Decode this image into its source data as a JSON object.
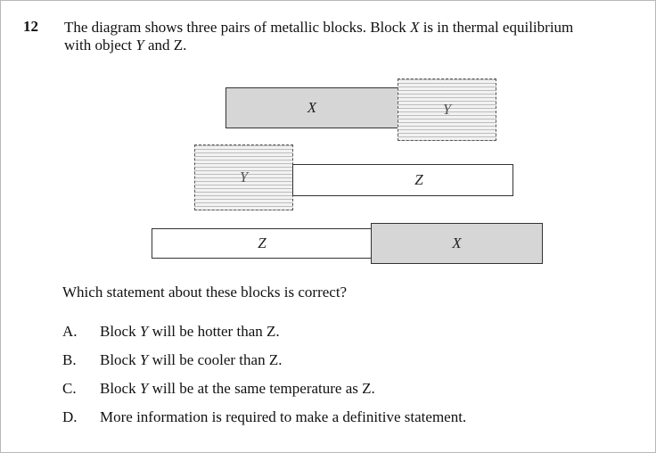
{
  "question": {
    "number": "12",
    "stem_line1_a": "The diagram shows three pairs of metallic blocks. Block ",
    "stem_line1_b": "X",
    "stem_line1_c": " is in thermal equilibrium",
    "stem_line2_a": "with object ",
    "stem_line2_b": "Y",
    "stem_line2_c": " and Z.",
    "prompt": "Which statement about these blocks is correct?"
  },
  "diagram": {
    "pair1": {
      "left": "X",
      "right": "Y"
    },
    "pair2": {
      "left": "Y",
      "right": "Z"
    },
    "pair3": {
      "left": "Z",
      "right": "X"
    }
  },
  "options": [
    {
      "letter": "A.",
      "pre": "Block ",
      "var": "Y",
      "post": " will be hotter than Z."
    },
    {
      "letter": "B.",
      "pre": "Block ",
      "var": "Y",
      "post": " will be cooler than Z."
    },
    {
      "letter": "C.",
      "pre": "Block ",
      "var": "Y",
      "post": " will be at the same temperature as Z."
    },
    {
      "letter": "D.",
      "pre": "More information is required to make a definitive statement.",
      "var": "",
      "post": ""
    }
  ]
}
